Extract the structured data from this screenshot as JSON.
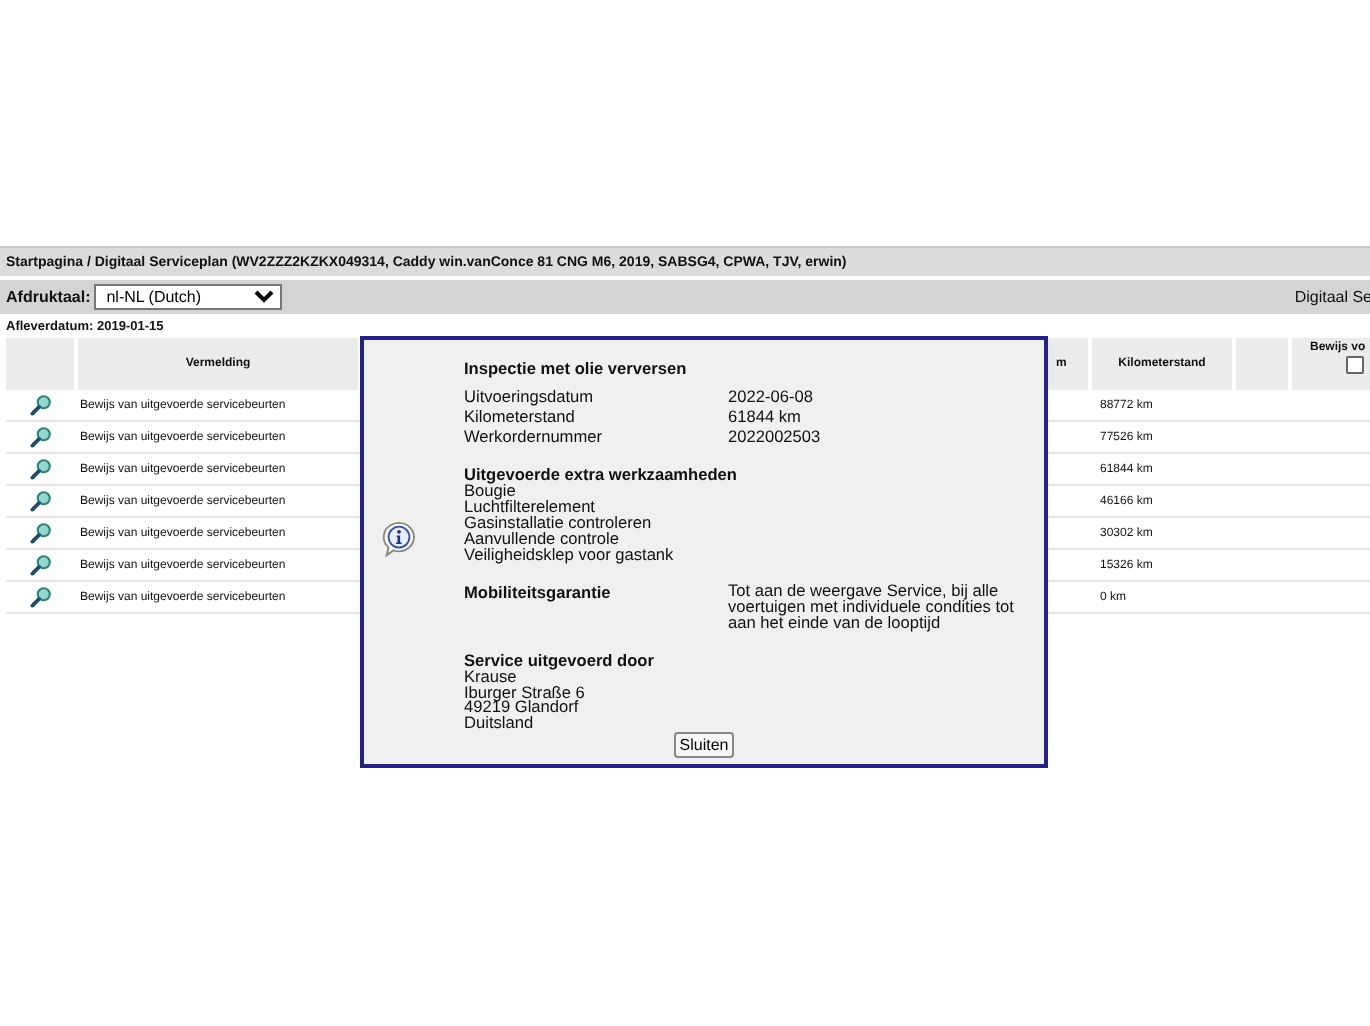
{
  "breadcrumb": "Startpagina / Digitaal Serviceplan (WV2ZZZ2KZKX049314, Caddy win.vanConce 81 CNG M6, 2019, SABSG4, CPWA, TJV, erwin)",
  "print_language": {
    "label": "Afdruktaal:",
    "value": "nl-NL (Dutch)"
  },
  "heading_right": "Digitaal Se",
  "delivery_date": "Afleverdatum: 2019-01-15",
  "table": {
    "columns": [
      "Vermelding",
      "m",
      "Kilometerstand",
      "Bewijs vo"
    ],
    "select_all_checked": false,
    "rows": [
      {
        "description": "Bewijs van uitgevoerde servicebeurten",
        "mileage": "88772 km"
      },
      {
        "description": "Bewijs van uitgevoerde servicebeurten",
        "mileage": "77526 km"
      },
      {
        "description": "Bewijs van uitgevoerde servicebeurten",
        "mileage": "61844 km"
      },
      {
        "description": "Bewijs van uitgevoerde servicebeurten",
        "mileage": "46166 km"
      },
      {
        "description": "Bewijs van uitgevoerde servicebeurten",
        "mileage": "30302 km"
      },
      {
        "description": "Bewijs van uitgevoerde servicebeurten",
        "mileage": "15326 km"
      },
      {
        "description": "Bewijs van uitgevoerde servicebeurten",
        "mileage": "0 km"
      }
    ]
  },
  "dialog": {
    "title": "Inspectie met olie verversen",
    "details": [
      {
        "label": "Uitvoeringsdatum",
        "value": "2022-06-08"
      },
      {
        "label": "Kilometerstand",
        "value": "61844 km"
      },
      {
        "label": "Werkordernummer",
        "value": "2022002503"
      }
    ],
    "extra_work": {
      "title": "Uitgevoerde extra werkzaamheden",
      "items": [
        "Bougie",
        "Luchtfilterelement",
        "Gasinstallatie controleren",
        "Aanvullende controle",
        "Veiligheidsklep voor gastank"
      ]
    },
    "guarantee": {
      "label": "Mobiliteitsgarantie",
      "text": "Tot aan de weergave Service, bij alle voertuigen met individuele condities tot aan het einde van de looptijd"
    },
    "service_by": {
      "title": "Service uitgevoerd door",
      "lines": [
        "Krause",
        "Iburger Straße 6",
        "49219 Glandorf",
        "Duitsland"
      ]
    },
    "close_button": "Sluiten"
  }
}
